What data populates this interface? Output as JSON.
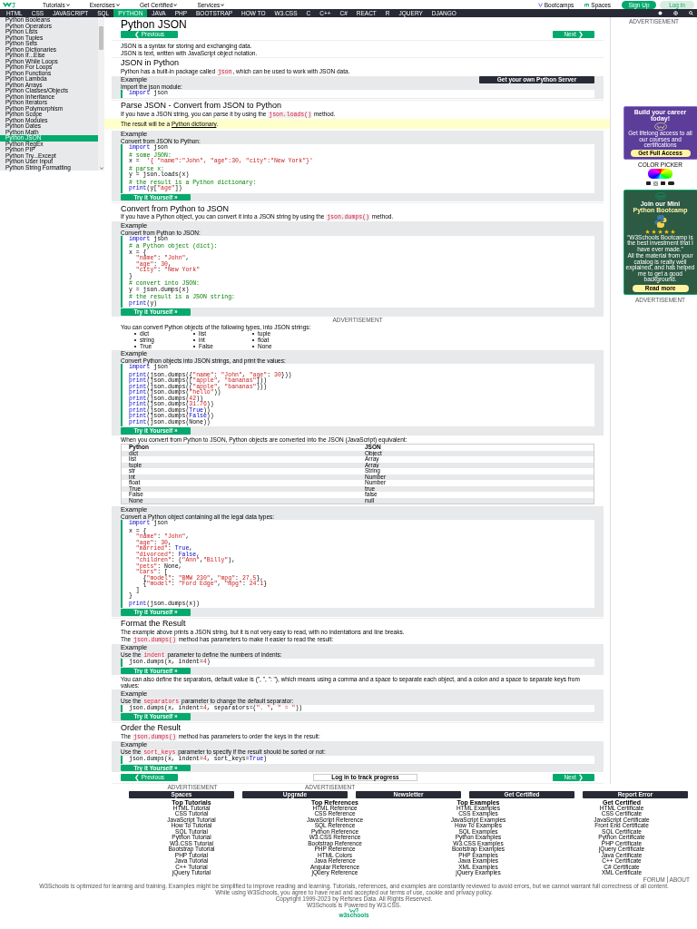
{
  "top_nav": {
    "menus": [
      "Tutorials",
      "Exercises",
      "Get Certified",
      "Services"
    ],
    "bootcamps": "Bootcamps",
    "spaces": "Spaces",
    "sign_up": "Sign Up",
    "log_in": "Log in"
  },
  "tabs": [
    {
      "label": "HTML",
      "selected": false
    },
    {
      "label": "CSS",
      "selected": false
    },
    {
      "label": "JAVASCRIPT",
      "selected": false
    },
    {
      "label": "SQL",
      "selected": false
    },
    {
      "label": "PYTHON",
      "selected": true
    },
    {
      "label": "JAVA",
      "selected": false
    },
    {
      "label": "PHP",
      "selected": false
    },
    {
      "label": "BOOTSTRAP",
      "selected": false
    },
    {
      "label": "HOW TO",
      "selected": false
    },
    {
      "label": "W3.CSS",
      "selected": false
    },
    {
      "label": "C",
      "selected": false
    },
    {
      "label": "C++",
      "selected": false
    },
    {
      "label": "C#",
      "selected": false
    },
    {
      "label": "REACT",
      "selected": false
    },
    {
      "label": "R",
      "selected": false
    },
    {
      "label": "JQUERY",
      "selected": false
    },
    {
      "label": "DJANGO",
      "selected": false
    }
  ],
  "sidebar": {
    "items": [
      {
        "label": "Python Booleans",
        "selected": false
      },
      {
        "label": "Python Operators",
        "selected": false
      },
      {
        "label": "Python Lists",
        "selected": false
      },
      {
        "label": "Python Tuples",
        "selected": false
      },
      {
        "label": "Python Sets",
        "selected": false
      },
      {
        "label": "Python Dictionaries",
        "selected": false
      },
      {
        "label": "Python If...Else",
        "selected": false
      },
      {
        "label": "Python While Loops",
        "selected": false
      },
      {
        "label": "Python For Loops",
        "selected": false
      },
      {
        "label": "Python Functions",
        "selected": false
      },
      {
        "label": "Python Lambda",
        "selected": false
      },
      {
        "label": "Python Arrays",
        "selected": false
      },
      {
        "label": "Python Classes/Objects",
        "selected": false
      },
      {
        "label": "Python Inheritance",
        "selected": false
      },
      {
        "label": "Python Iterators",
        "selected": false
      },
      {
        "label": "Python Polymorphism",
        "selected": false
      },
      {
        "label": "Python Scope",
        "selected": false
      },
      {
        "label": "Python Modules",
        "selected": false
      },
      {
        "label": "Python Dates",
        "selected": false
      },
      {
        "label": "Python Math",
        "selected": false
      },
      {
        "label": "Python JSON",
        "selected": true
      },
      {
        "label": "Python RegEx",
        "selected": false
      },
      {
        "label": "Python PIP",
        "selected": false
      },
      {
        "label": "Python Try...Except",
        "selected": false
      },
      {
        "label": "Python User Input",
        "selected": false
      },
      {
        "label": "Python String Formatting",
        "selected": false
      }
    ]
  },
  "content": [
    {
      "kind": "h1",
      "text": "Python JSON"
    },
    {
      "kind": "nav",
      "prev": "❮ Previous",
      "next": "Next ❯"
    },
    {
      "kind": "p",
      "parts": [
        {
          "kind": "text",
          "text": "JSON is a syntax for storing and exchanging data."
        }
      ]
    },
    {
      "kind": "p",
      "parts": [
        {
          "kind": "text",
          "text": "JSON is text, written with JavaScript object notation."
        }
      ]
    },
    {
      "kind": "h2",
      "text": "JSON in Python"
    },
    {
      "kind": "p",
      "parts": [
        {
          "kind": "text",
          "text": "Python has a built-in package called "
        },
        {
          "kind": "code",
          "text": "json"
        },
        {
          "kind": "text",
          "text": ", which can be used to work with JSON data."
        }
      ]
    },
    {
      "kind": "example",
      "title": "Example",
      "server_button": "Get your own Python Server",
      "intro": [
        {
          "kind": "text",
          "text": "Import the json module:"
        }
      ],
      "code": [
        [
          [
            {
              "kind": "keyword",
              "text": "import"
            },
            {
              "kind": "plain",
              "text": " json"
            }
          ]
        ]
      ]
    },
    {
      "kind": "h2",
      "text": "Parse JSON - Convert from JSON to Python"
    },
    {
      "kind": "p",
      "parts": [
        {
          "kind": "text",
          "text": "If you have a JSON string, you can parse it by using the "
        },
        {
          "kind": "code",
          "text": "json.loads()"
        },
        {
          "kind": "text",
          "text": " method."
        }
      ]
    },
    {
      "kind": "note",
      "parts": [
        {
          "kind": "text",
          "text": "The result will be a "
        },
        {
          "kind": "link",
          "text": "Python dictionary"
        },
        {
          "kind": "text",
          "text": "."
        }
      ]
    },
    {
      "kind": "example",
      "title": "Example",
      "intro": [
        {
          "kind": "text",
          "text": "Convert from JSON to Python:"
        }
      ],
      "try_button": "Try it Yourself »",
      "code": [
        [
          [
            {
              "kind": "keyword",
              "text": "import"
            },
            {
              "kind": "plain",
              "text": " json"
            }
          ]
        ],
        [
          [
            {
              "kind": "comment",
              "text": "# some JSON:"
            }
          ],
          [
            {
              "kind": "plain",
              "text": "x =  "
            },
            {
              "kind": "string",
              "text": "'{ \"name\":\"John\", \"age\":30, \"city\":\"New York\"}'"
            }
          ]
        ],
        [
          [
            {
              "kind": "comment",
              "text": "# parse x:"
            }
          ],
          [
            {
              "kind": "plain",
              "text": "y = json.loads(x)"
            }
          ]
        ],
        [
          [
            {
              "kind": "comment",
              "text": "# the result is a Python dictionary:"
            }
          ],
          [
            {
              "kind": "keyword",
              "text": "print"
            },
            {
              "kind": "plain",
              "text": "(y["
            },
            {
              "kind": "string",
              "text": "\"age\""
            },
            {
              "kind": "plain",
              "text": "])"
            }
          ]
        ]
      ]
    },
    {
      "kind": "h2",
      "text": "Convert from Python to JSON"
    },
    {
      "kind": "p",
      "parts": [
        {
          "kind": "text",
          "text": "If you have a Python object, you can convert it into a JSON string by using the "
        },
        {
          "kind": "code",
          "text": "json.dumps()"
        },
        {
          "kind": "text",
          "text": " method."
        }
      ]
    },
    {
      "kind": "example",
      "title": "Example",
      "intro": [
        {
          "kind": "text",
          "text": "Convert from Python to JSON:"
        }
      ],
      "try_button": "Try it Yourself »",
      "code": [
        [
          [
            {
              "kind": "keyword",
              "text": "import"
            },
            {
              "kind": "plain",
              "text": " json"
            }
          ]
        ],
        [
          [
            {
              "kind": "comment",
              "text": "# a Python object (dict):"
            }
          ],
          [
            {
              "kind": "plain",
              "text": "x = {"
            }
          ],
          [
            {
              "kind": "string",
              "text": "  \"name\""
            },
            {
              "kind": "plain",
              "text": ": "
            },
            {
              "kind": "string",
              "text": "\"John\""
            },
            {
              "kind": "plain",
              "text": ","
            }
          ],
          [
            {
              "kind": "string",
              "text": "  \"age\""
            },
            {
              "kind": "plain",
              "text": ": "
            },
            {
              "kind": "number",
              "text": "30"
            },
            {
              "kind": "plain",
              "text": ","
            }
          ],
          [
            {
              "kind": "string",
              "text": "  \"city\""
            },
            {
              "kind": "plain",
              "text": ": "
            },
            {
              "kind": "string",
              "text": "\"New York\""
            }
          ],
          [
            {
              "kind": "plain",
              "text": "}"
            }
          ]
        ],
        [
          [
            {
              "kind": "comment",
              "text": "# convert into JSON:"
            }
          ],
          [
            {
              "kind": "plain",
              "text": "y = json.dumps(x)"
            }
          ]
        ],
        [
          [
            {
              "kind": "comment",
              "text": "# the result is a JSON string:"
            }
          ],
          [
            {
              "kind": "keyword",
              "text": "print"
            },
            {
              "kind": "plain",
              "text": "(y)"
            }
          ]
        ]
      ]
    },
    {
      "kind": "ad",
      "text": "ADVERTISEMENT"
    },
    {
      "kind": "p",
      "parts": [
        {
          "kind": "text",
          "text": "You can convert Python objects of the following types, into JSON strings:"
        }
      ]
    },
    {
      "kind": "list",
      "items": [
        "dict",
        "list",
        "tuple",
        "string",
        "int",
        "float",
        "True",
        "False",
        "None"
      ]
    },
    {
      "kind": "example",
      "title": "Example",
      "intro": [
        {
          "kind": "text",
          "text": "Convert Python objects into JSON strings, and print the values:"
        }
      ],
      "try_button": "Try it Yourself »",
      "code": [
        [
          [
            {
              "kind": "keyword",
              "text": "import"
            },
            {
              "kind": "plain",
              "text": " json"
            }
          ]
        ],
        [
          [
            {
              "kind": "keyword",
              "text": "print"
            },
            {
              "kind": "plain",
              "text": "(json.dumps({"
            },
            {
              "kind": "string",
              "text": "\"name\""
            },
            {
              "kind": "plain",
              "text": ": "
            },
            {
              "kind": "string",
              "text": "\"John\""
            },
            {
              "kind": "plain",
              "text": ", "
            },
            {
              "kind": "string",
              "text": "\"age\""
            },
            {
              "kind": "plain",
              "text": ": "
            },
            {
              "kind": "number",
              "text": "30"
            },
            {
              "kind": "plain",
              "text": "}))"
            }
          ],
          [
            {
              "kind": "keyword",
              "text": "print"
            },
            {
              "kind": "plain",
              "text": "(json.dumps(["
            },
            {
              "kind": "string",
              "text": "\"apple\""
            },
            {
              "kind": "plain",
              "text": ", "
            },
            {
              "kind": "string",
              "text": "\"bananas\""
            },
            {
              "kind": "plain",
              "text": "]))"
            }
          ],
          [
            {
              "kind": "keyword",
              "text": "print"
            },
            {
              "kind": "plain",
              "text": "(json.dumps(("
            },
            {
              "kind": "string",
              "text": "\"apple\""
            },
            {
              "kind": "plain",
              "text": ", "
            },
            {
              "kind": "string",
              "text": "\"bananas\""
            },
            {
              "kind": "plain",
              "text": ")))"
            }
          ],
          [
            {
              "kind": "keyword",
              "text": "print"
            },
            {
              "kind": "plain",
              "text": "(json.dumps("
            },
            {
              "kind": "string",
              "text": "\"hello\""
            },
            {
              "kind": "plain",
              "text": "))"
            }
          ],
          [
            {
              "kind": "keyword",
              "text": "print"
            },
            {
              "kind": "plain",
              "text": "(json.dumps("
            },
            {
              "kind": "number",
              "text": "42"
            },
            {
              "kind": "plain",
              "text": "))"
            }
          ],
          [
            {
              "kind": "keyword",
              "text": "print"
            },
            {
              "kind": "plain",
              "text": "(json.dumps("
            },
            {
              "kind": "number",
              "text": "31.76"
            },
            {
              "kind": "plain",
              "text": "))"
            }
          ],
          [
            {
              "kind": "keyword",
              "text": "print"
            },
            {
              "kind": "plain",
              "text": "(json.dumps("
            },
            {
              "kind": "keyword",
              "text": "True"
            },
            {
              "kind": "plain",
              "text": "))"
            }
          ],
          [
            {
              "kind": "keyword",
              "text": "print"
            },
            {
              "kind": "plain",
              "text": "(json.dumps("
            },
            {
              "kind": "keyword",
              "text": "False"
            },
            {
              "kind": "plain",
              "text": "))"
            }
          ],
          [
            {
              "kind": "keyword",
              "text": "print"
            },
            {
              "kind": "plain",
              "text": "(json.dumps(None))"
            }
          ]
        ]
      ]
    },
    {
      "kind": "p",
      "parts": [
        {
          "kind": "text",
          "text": "When you convert from Python to JSON, Python objects are converted into the JSON (JavaScript) equivalent:"
        }
      ]
    },
    {
      "kind": "table",
      "columns": [
        "Python",
        "JSON"
      ],
      "rows": [
        [
          "dict",
          "Object"
        ],
        [
          "list",
          "Array"
        ],
        [
          "tuple",
          "Array"
        ],
        [
          "str",
          "String"
        ],
        [
          "int",
          "Number"
        ],
        [
          "float",
          "Number"
        ],
        [
          "True",
          "true"
        ],
        [
          "False",
          "false"
        ],
        [
          "None",
          "null"
        ]
      ]
    },
    {
      "kind": "example",
      "title": "Example",
      "intro": [
        {
          "kind": "text",
          "text": "Convert a Python object containing all the legal data types:"
        }
      ],
      "try_button": "Try it Yourself »",
      "code": [
        [
          [
            {
              "kind": "keyword",
              "text": "import"
            },
            {
              "kind": "plain",
              "text": " json"
            }
          ]
        ],
        [
          [
            {
              "kind": "plain",
              "text": "x = {"
            }
          ],
          [
            {
              "kind": "string",
              "text": "  \"name\""
            },
            {
              "kind": "plain",
              "text": ": "
            },
            {
              "kind": "string",
              "text": "\"John\""
            },
            {
              "kind": "plain",
              "text": ","
            }
          ],
          [
            {
              "kind": "string",
              "text": "  \"age\""
            },
            {
              "kind": "plain",
              "text": ": "
            },
            {
              "kind": "number",
              "text": "30"
            },
            {
              "kind": "plain",
              "text": ","
            }
          ],
          [
            {
              "kind": "string",
              "text": "  \"married\""
            },
            {
              "kind": "plain",
              "text": ": "
            },
            {
              "kind": "keyword",
              "text": "True"
            },
            {
              "kind": "plain",
              "text": ","
            }
          ],
          [
            {
              "kind": "string",
              "text": "  \"divorced\""
            },
            {
              "kind": "plain",
              "text": ": "
            },
            {
              "kind": "keyword",
              "text": "False"
            },
            {
              "kind": "plain",
              "text": ","
            }
          ],
          [
            {
              "kind": "string",
              "text": "  \"children\""
            },
            {
              "kind": "plain",
              "text": ": ("
            },
            {
              "kind": "string",
              "text": "\"Ann\""
            },
            {
              "kind": "plain",
              "text": ","
            },
            {
              "kind": "string",
              "text": "\"Billy\""
            },
            {
              "kind": "plain",
              "text": "),"
            }
          ],
          [
            {
              "kind": "string",
              "text": "  \"pets\""
            },
            {
              "kind": "plain",
              "text": ": None,"
            }
          ],
          [
            {
              "kind": "string",
              "text": "  \"cars\""
            },
            {
              "kind": "plain",
              "text": ": ["
            }
          ],
          [
            {
              "kind": "plain",
              "text": "    {"
            },
            {
              "kind": "string",
              "text": "\"model\""
            },
            {
              "kind": "plain",
              "text": ": "
            },
            {
              "kind": "string",
              "text": "\"BMW 230\""
            },
            {
              "kind": "plain",
              "text": ", "
            },
            {
              "kind": "string",
              "text": "\"mpg\""
            },
            {
              "kind": "plain",
              "text": ": "
            },
            {
              "kind": "number",
              "text": "27.5"
            },
            {
              "kind": "plain",
              "text": "},"
            }
          ],
          [
            {
              "kind": "plain",
              "text": "    {"
            },
            {
              "kind": "string",
              "text": "\"model\""
            },
            {
              "kind": "plain",
              "text": ": "
            },
            {
              "kind": "string",
              "text": "\"Ford Edge\""
            },
            {
              "kind": "plain",
              "text": ", "
            },
            {
              "kind": "string",
              "text": "\"mpg\""
            },
            {
              "kind": "plain",
              "text": ": "
            },
            {
              "kind": "number",
              "text": "24.1"
            },
            {
              "kind": "plain",
              "text": "}"
            }
          ],
          [
            {
              "kind": "plain",
              "text": "  ]"
            }
          ],
          [
            {
              "kind": "plain",
              "text": "}"
            }
          ]
        ],
        [
          [
            {
              "kind": "keyword",
              "text": "print"
            },
            {
              "kind": "plain",
              "text": "(json.dumps(x))"
            }
          ]
        ]
      ]
    },
    {
      "kind": "h2",
      "text": "Format the Result"
    },
    {
      "kind": "p",
      "parts": [
        {
          "kind": "text",
          "text": "The example above prints a JSON string, but it is not very easy to read, with no indentations and line breaks."
        }
      ]
    },
    {
      "kind": "p",
      "parts": [
        {
          "kind": "text",
          "text": "The "
        },
        {
          "kind": "code",
          "text": "json.dumps()"
        },
        {
          "kind": "text",
          "text": " method has parameters to make it easier to read the result:"
        }
      ]
    },
    {
      "kind": "example",
      "title": "Example",
      "intro": [
        {
          "kind": "text",
          "text": "Use the "
        },
        {
          "kind": "code",
          "text": "indent"
        },
        {
          "kind": "text",
          "text": " parameter to define the numbers of indents:"
        }
      ],
      "try_button": "Try it Yourself »",
      "code": [
        [
          [
            {
              "kind": "plain",
              "text": "json.dumps(x, indent="
            },
            {
              "kind": "number",
              "text": "4"
            },
            {
              "kind": "plain",
              "text": ")"
            }
          ]
        ]
      ]
    },
    {
      "kind": "p",
      "parts": [
        {
          "kind": "text",
          "text": "You can also define the separators, default value is (\", \", \": \"), which means using a comma and a space to separate each object, and a colon and a space to separate keys from values:"
        }
      ]
    },
    {
      "kind": "example",
      "title": "Example",
      "intro": [
        {
          "kind": "text",
          "text": "Use the "
        },
        {
          "kind": "code",
          "text": "separators"
        },
        {
          "kind": "text",
          "text": " parameter to change the default separator:"
        }
      ],
      "try_button": "Try it Yourself »",
      "code": [
        [
          [
            {
              "kind": "plain",
              "text": "json.dumps(x, indent="
            },
            {
              "kind": "number",
              "text": "4"
            },
            {
              "kind": "plain",
              "text": ", separators=("
            },
            {
              "kind": "string",
              "text": "\". \""
            },
            {
              "kind": "plain",
              "text": ", "
            },
            {
              "kind": "string",
              "text": "\" = \""
            },
            {
              "kind": "plain",
              "text": "))"
            }
          ]
        ]
      ]
    },
    {
      "kind": "h2",
      "text": "Order the Result"
    },
    {
      "kind": "p",
      "parts": [
        {
          "kind": "text",
          "text": "The "
        },
        {
          "kind": "code",
          "text": "json.dumps()"
        },
        {
          "kind": "text",
          "text": " method has parameters to order the keys in the result:"
        }
      ]
    },
    {
      "kind": "example",
      "title": "Example",
      "intro": [
        {
          "kind": "text",
          "text": "Use the "
        },
        {
          "kind": "code",
          "text": "sort_keys"
        },
        {
          "kind": "text",
          "text": " parameter to specify if the result should be sorted or not:"
        }
      ],
      "try_button": "Try it Yourself »",
      "code": [
        [
          [
            {
              "kind": "plain",
              "text": "json.dumps(x, indent="
            },
            {
              "kind": "number",
              "text": "4"
            },
            {
              "kind": "plain",
              "text": ", sort_keys="
            },
            {
              "kind": "keyword",
              "text": "True"
            },
            {
              "kind": "plain",
              "text": ")"
            }
          ]
        ]
      ]
    },
    {
      "kind": "nav",
      "prev": "❮ Previous",
      "middle": "Log in to track progress",
      "next": "Next ❯"
    }
  ],
  "right_column": {
    "ad_label_top": "ADVERTISEMENT",
    "career_ad": {
      "title": "Build your career today!",
      "text": "Get lifelong access to all our courses and certifications",
      "button": "Get Full Access"
    },
    "color_picker": "COLOR PICKER",
    "bootcamp_ad": {
      "title": "Join our Mini",
      "highlight": "Python Bootcamp",
      "stars": 5,
      "quote": "“W3Schools Bootcamp is the best investment that I have ever made.”",
      "text": "All the material from your catalog is really well explained, and has helped me to get a good background.",
      "button": "Read more"
    },
    "ad_label_bottom": "ADVERTISEMENT"
  },
  "footer": {
    "ad_labels": [
      "ADVERTISEMENT",
      "ADVERTISEMENT"
    ],
    "buttons": [
      "Spaces",
      "Upgrade",
      "Newsletter",
      "Get Certified",
      "Report Error"
    ],
    "columns": [
      {
        "title": "Top Tutorials",
        "links": [
          "HTML Tutorial",
          "CSS Tutorial",
          "JavaScript Tutorial",
          "How To Tutorial",
          "SQL Tutorial",
          "Python Tutorial",
          "W3.CSS Tutorial",
          "Bootstrap Tutorial",
          "PHP Tutorial",
          "Java Tutorial",
          "C++ Tutorial",
          "jQuery Tutorial"
        ]
      },
      {
        "title": "Top References",
        "links": [
          "HTML Reference",
          "CSS Reference",
          "JavaScript Reference",
          "SQL Reference",
          "Python Reference",
          "W3.CSS Reference",
          "Bootstrap Reference",
          "PHP Reference",
          "HTML Colors",
          "Java Reference",
          "Angular Reference",
          "jQuery Reference"
        ]
      },
      {
        "title": "Top Examples",
        "links": [
          "HTML Examples",
          "CSS Examples",
          "JavaScript Examples",
          "How To Examples",
          "SQL Examples",
          "Python Examples",
          "W3.CSS Examples",
          "Bootstrap Examples",
          "PHP Examples",
          "Java Examples",
          "XML Examples",
          "jQuery Examples"
        ]
      },
      {
        "title": "Get Certified",
        "links": [
          "HTML Certificate",
          "CSS Certificate",
          "JavaScript Certificate",
          "Front End Certificate",
          "SQL Certificate",
          "Python Certificate",
          "PHP Certificate",
          "jQuery Certificate",
          "Java Certificate",
          "C++ Certificate",
          "C# Certificate",
          "XML Certificate"
        ]
      }
    ],
    "links": [
      "FORUM",
      "ABOUT"
    ],
    "disclaimer": "W3Schools is optimized for learning and training. Examples might be simplified to improve reading and learning. Tutorials, references, and examples are constantly reviewed to avoid errors, but we cannot warrant full correctness of all content. While using W3Schools, you agree to have read and accepted our terms of use, cookie and privacy policy.",
    "copyright": "Copyright 1999-2023 by Refsnes Data. All Rights Reserved.",
    "powered": "W3Schools is Powered by W3.CSS.",
    "logo_text": "w3schools"
  }
}
